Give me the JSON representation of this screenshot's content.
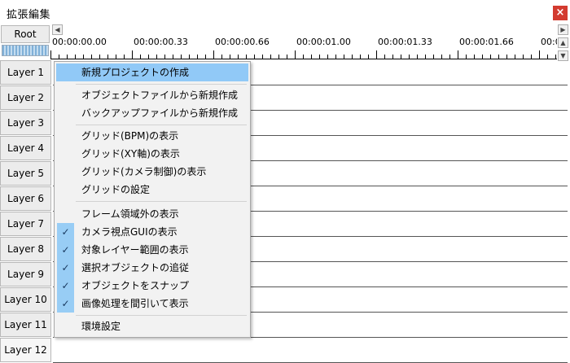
{
  "window": {
    "title": "拡張編集",
    "close_label": "×"
  },
  "root_button": "Root",
  "scroll": {
    "left": "◀",
    "right": "▶",
    "up": "▲",
    "down": "▼"
  },
  "ruler": {
    "labels": [
      "00:00:00.00",
      "00:00:00.33",
      "00:00:00.66",
      "00:00:01.00",
      "00:00:01.33",
      "00:00:01.66",
      "00:0"
    ]
  },
  "layers": [
    "Layer 1",
    "Layer 2",
    "Layer 3",
    "Layer 4",
    "Layer 5",
    "Layer 6",
    "Layer 7",
    "Layer 8",
    "Layer 9",
    "Layer 10",
    "Layer 11",
    "Layer 12"
  ],
  "context_menu": {
    "items": [
      {
        "label": "新規プロジェクトの作成",
        "checked": false,
        "highlighted": true
      },
      {
        "label": "オブジェクトファイルから新規作成",
        "checked": false
      },
      {
        "label": "バックアップファイルから新規作成",
        "checked": false
      },
      {
        "label": "グリッド(BPM)の表示",
        "checked": false
      },
      {
        "label": "グリッド(XY軸)の表示",
        "checked": false
      },
      {
        "label": "グリッド(カメラ制御)の表示",
        "checked": false
      },
      {
        "label": "グリッドの設定",
        "checked": false
      },
      {
        "label": "フレーム領域外の表示",
        "checked": false
      },
      {
        "label": "カメラ視点GUIの表示",
        "checked": true
      },
      {
        "label": "対象レイヤー範囲の表示",
        "checked": true
      },
      {
        "label": "選択オブジェクトの追従",
        "checked": true
      },
      {
        "label": "オブジェクトをスナップ",
        "checked": true
      },
      {
        "label": "画像処理を間引いて表示",
        "checked": true
      },
      {
        "label": "環境設定",
        "checked": false
      }
    ],
    "check_glyph": "✓"
  }
}
